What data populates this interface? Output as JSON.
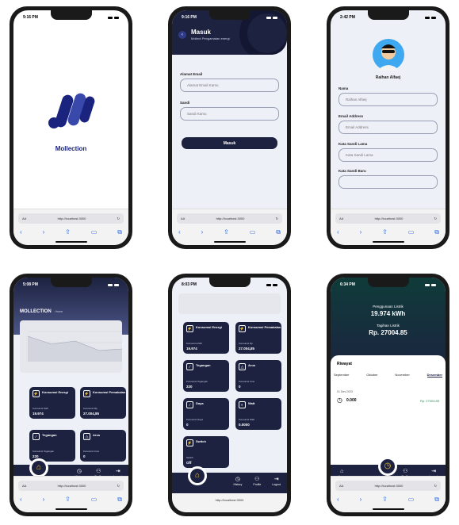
{
  "status_times": [
    "9:16 PM",
    "9:16 PM",
    "2:42 PM",
    "5:08 PM",
    "8:03 PM",
    "6:34 PM"
  ],
  "safari": {
    "aa": "AA",
    "url": "http://localhost:3000",
    "url_alt": "http://localhost:3000"
  },
  "splash": {
    "brand": "Mollection"
  },
  "login": {
    "title": "Masuk",
    "subtitle": "Mollect Pengamatan energi",
    "email_label": "Alamat Email",
    "email_placeholder": "Alamat Email Kamu",
    "password_label": "Sandi",
    "password_placeholder": "Sandi Kamu",
    "submit": "Masuk"
  },
  "profile": {
    "name": "Raihan Alfaej",
    "fields": [
      {
        "label": "Nama",
        "value": "Raihan Alfaej"
      },
      {
        "label": "Email Address",
        "value": "Email Address"
      },
      {
        "label": "Kata Sandi Lama",
        "value": "Kata Sandi Lama"
      },
      {
        "label": "Kata Sandi Baru",
        "value": ""
      }
    ]
  },
  "dashboard": {
    "title": "MOLLECTION",
    "subtitle": "◦ Home",
    "cards": [
      {
        "title": "Konsumsi Energi",
        "label": "Konsumsi kWh",
        "value": "19.974"
      },
      {
        "title": "Konsumsi Pemakaian",
        "label": "Konsumsi Rp",
        "value": "27.004,85"
      },
      {
        "title": "Tegangan",
        "label": "Konsumsi Tegangan",
        "value": "220"
      },
      {
        "title": "Arus",
        "label": "Konsumsi Arus",
        "value": "0"
      }
    ],
    "tabs": [
      {
        "icon": "◷",
        "label": "History"
      },
      {
        "icon": "⚇",
        "label": "Profile"
      },
      {
        "icon": "⇥",
        "label": "Logout"
      }
    ]
  },
  "dashboard2": {
    "cards": [
      {
        "title": "Konsumsi Energi",
        "label": "Konsumsi kWh",
        "value": "19.974"
      },
      {
        "title": "Konsumsi Pemakaian",
        "label": "Konsumsi Rp",
        "value": "27.004,85"
      },
      {
        "title": "Tegangan",
        "label": "Konsumsi Tegangan",
        "value": "220"
      },
      {
        "title": "Arus",
        "label": "Konsumsi Arus",
        "value": "0"
      },
      {
        "title": "Daya",
        "label": "Konsumsi Daya",
        "value": "0"
      },
      {
        "title": "Watt",
        "label": "Konsumsi Watt",
        "value": "0.0000"
      },
      {
        "title": "Switch",
        "label": "Switch",
        "value": "Off"
      }
    ]
  },
  "history": {
    "usage_label": "Penggunaan Listrik",
    "usage_value": "19.974 kWh",
    "bill_label": "Tagihan Listrik",
    "bill_value": "Rp. 27004.85",
    "section": "Riwayat",
    "months": [
      "September",
      "Oktober",
      "November",
      "Desember"
    ],
    "entry_date": "01 Des 2023",
    "entry_value": "0.000",
    "entry_price": "Rp. 27004.85",
    "tabs": [
      {
        "icon": "⌂",
        "label": "Home"
      },
      {
        "icon": "⚇",
        "label": "Profile"
      },
      {
        "icon": "⇥",
        "label": "Logout"
      }
    ]
  }
}
